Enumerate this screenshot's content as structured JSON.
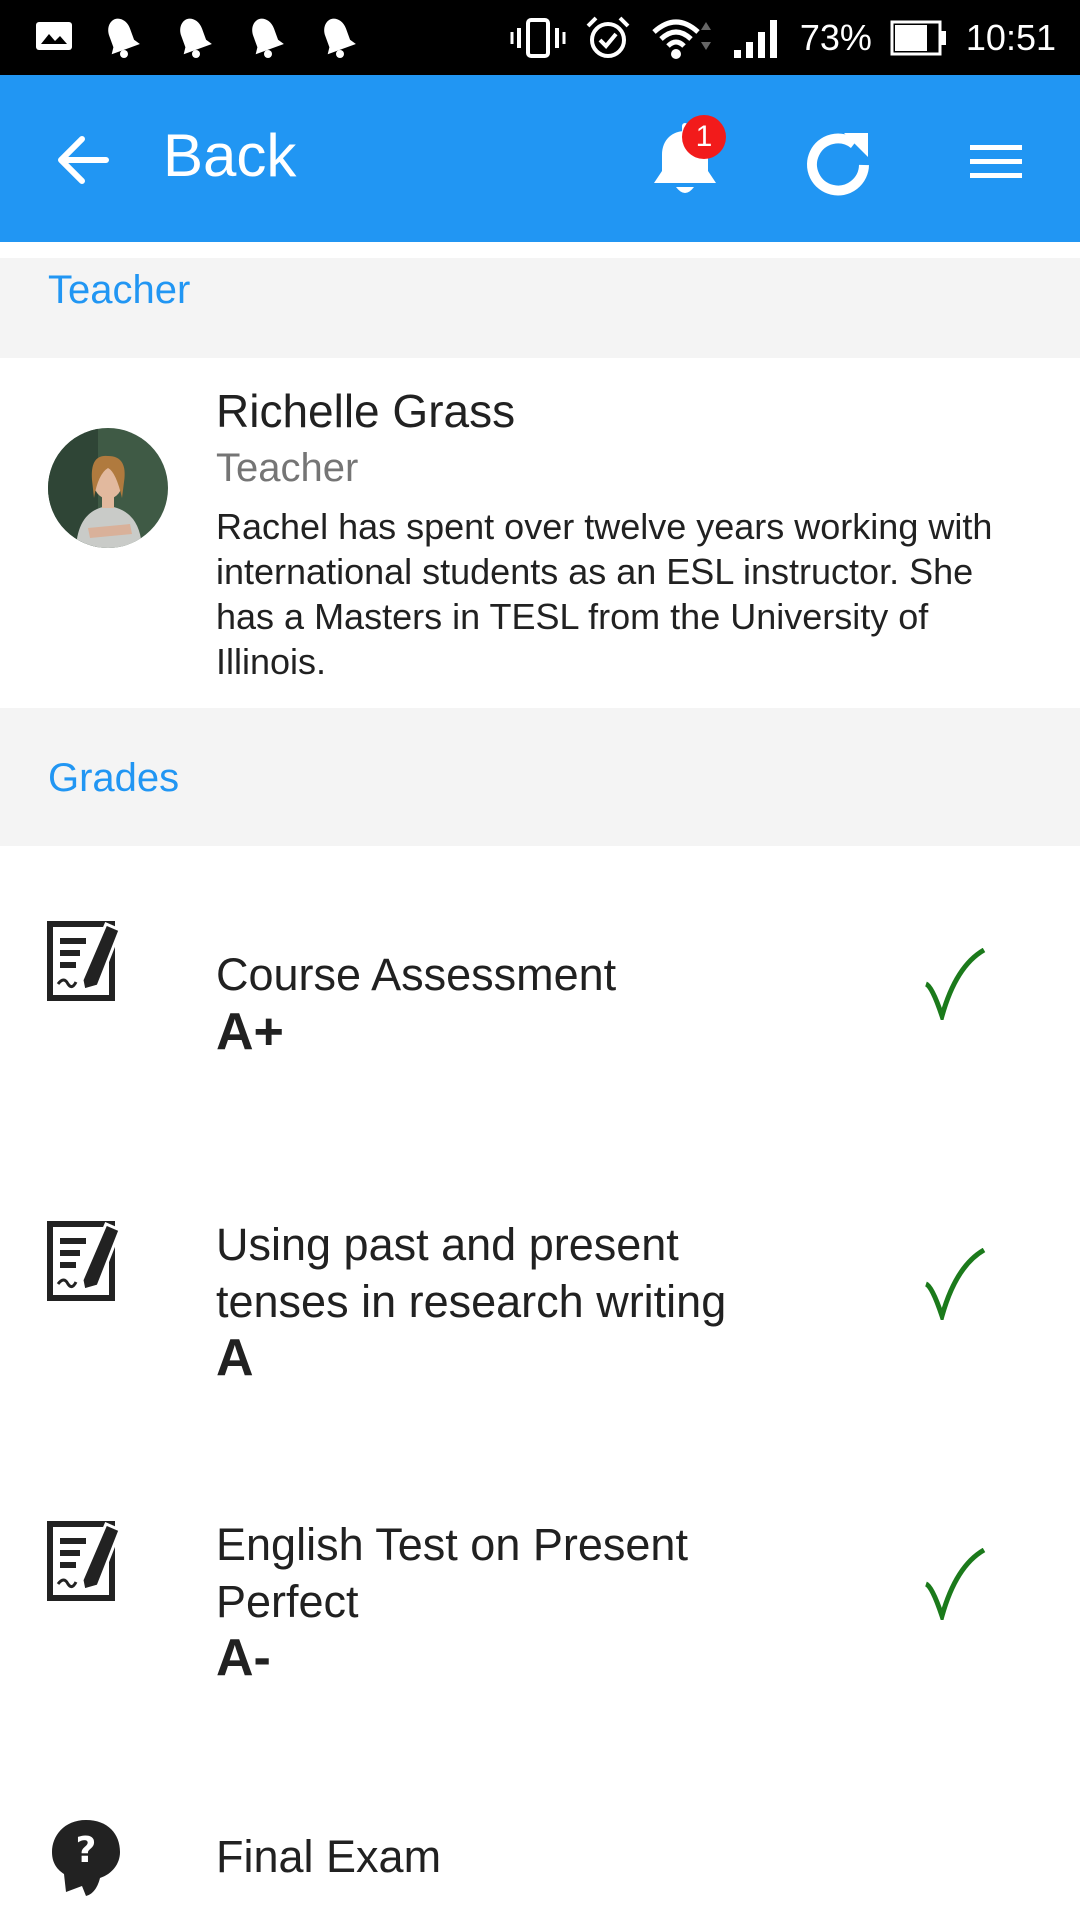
{
  "status_bar": {
    "battery": "73%",
    "time": "10:51",
    "left_icons": [
      "gallery-icon",
      "notification-bell-icon",
      "notification-bell-icon",
      "notification-bell-icon",
      "notification-bell-icon"
    ],
    "right_icons": [
      "vibrate-icon",
      "alarm-icon",
      "wifi-icon",
      "signal-icon",
      "battery-icon"
    ]
  },
  "app_bar": {
    "back_label": "Back",
    "notification_count": "1",
    "color": "#2196F3"
  },
  "teacher_section": {
    "header": "Teacher",
    "name": "Richelle Grass",
    "role": "Teacher",
    "bio": "Rachel has spent over twelve years working with international students as an ESL instructor. She has a Masters in TESL from the University of Illinois."
  },
  "grades_section": {
    "header": "Grades",
    "items": [
      {
        "title": "Course Assessment",
        "grade": "A+",
        "icon": "assignment-edit-icon",
        "status": "completed"
      },
      {
        "title": "Using past and present tenses in research writing",
        "grade": "A",
        "icon": "assignment-edit-icon",
        "status": "completed"
      },
      {
        "title": "English Test on Present Perfect",
        "grade": "A-",
        "icon": "assignment-edit-icon",
        "status": "completed"
      },
      {
        "title": "Final Exam",
        "grade": "",
        "icon": "question-head-icon",
        "status": "pending"
      }
    ]
  },
  "colors": {
    "accent": "#2196F3",
    "check": "#1B7A1B",
    "section_bg": "#F4F4F4",
    "badge": "#F21B1B"
  }
}
